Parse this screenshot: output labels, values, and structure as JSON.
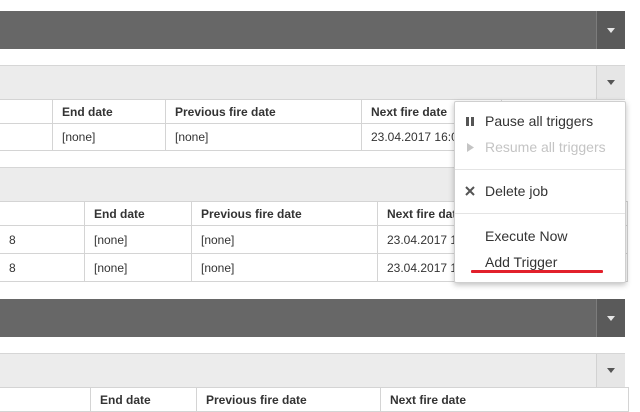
{
  "jobs": [
    {
      "headers": {
        "end": "End date",
        "prev": "Previous fire date",
        "next": "Next fire date"
      },
      "rows": [
        {
          "start": "",
          "end": "[none]",
          "prev": "[none]",
          "next": "23.04.2017 16:0"
        }
      ]
    },
    {
      "headers": {
        "end": "End date",
        "prev": "Previous fire date",
        "next": "Next fire date"
      },
      "rows": [
        {
          "start": "8",
          "end": "[none]",
          "prev": "[none]",
          "next": "23.04.2017 1"
        },
        {
          "start": "8",
          "end": "[none]",
          "prev": "[none]",
          "next": "23.04.2017 1"
        }
      ]
    },
    {
      "headers": {
        "end": "End date",
        "prev": "Previous fire date",
        "next": "Next fire date"
      }
    }
  ],
  "menu": {
    "pause": "Pause all triggers",
    "resume": "Resume all triggers",
    "delete": "Delete job",
    "execute": "Execute Now",
    "add_trigger": "Add Trigger"
  },
  "colors": {
    "highlight_underline": "#e2202b"
  }
}
